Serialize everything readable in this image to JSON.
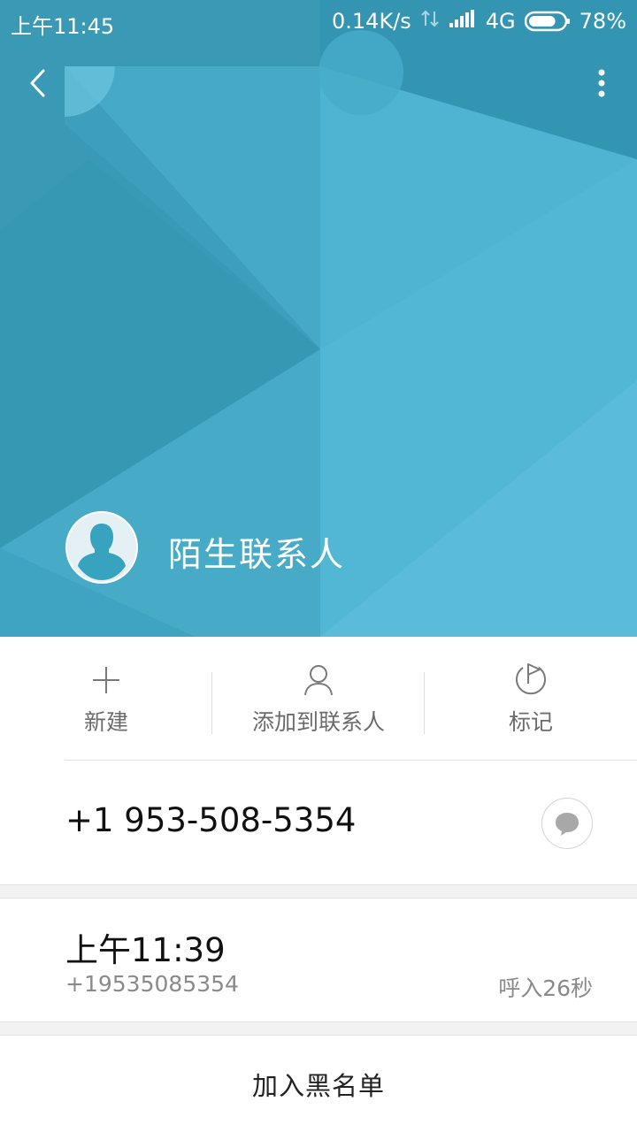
{
  "status_bar": {
    "time": "上午11:45",
    "net_speed": "0.14K/s",
    "network_type": "4G",
    "battery": "78%",
    "battery_level": 0.78
  },
  "header": {
    "contact_name": "陌生联系人",
    "colors": {
      "base": "#3a9ab6",
      "light": "#5bbcd9",
      "mid": "#4aaecb"
    }
  },
  "actions": [
    {
      "label": "新建",
      "icon": "plus-icon"
    },
    {
      "label": "添加到联系人",
      "icon": "person-icon"
    },
    {
      "label": "标记",
      "icon": "flag-icon"
    }
  ],
  "phone": {
    "number": "+1 953-508-5354"
  },
  "call_log": [
    {
      "time": "上午11:39",
      "number": "+19535085354",
      "desc": "呼入26秒"
    }
  ],
  "blacklist_label": "加入黑名单"
}
